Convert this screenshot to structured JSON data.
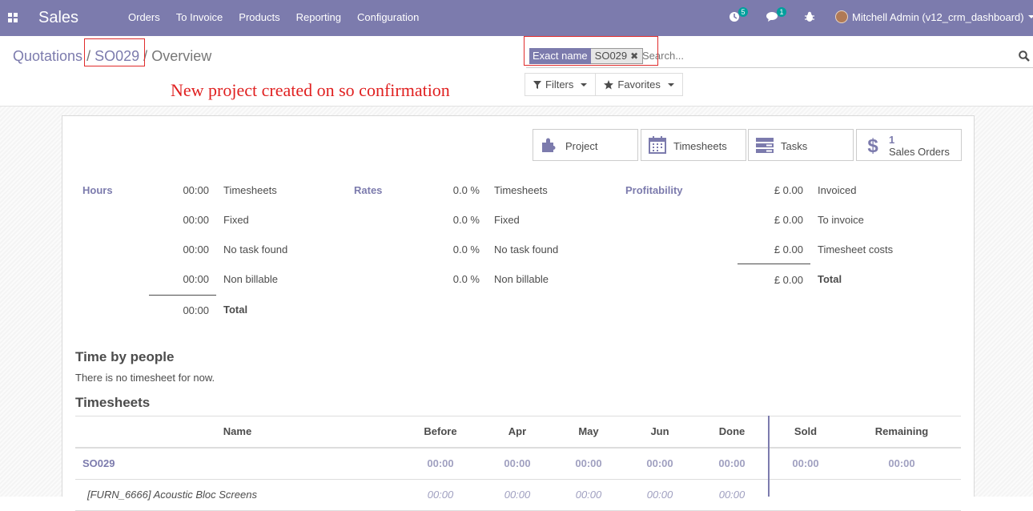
{
  "navbar": {
    "app_name": "Sales",
    "menu": [
      "Orders",
      "To Invoice",
      "Products",
      "Reporting",
      "Configuration"
    ],
    "activity_count": "5",
    "message_count": "1",
    "user_name": "Mitchell Admin (v12_crm_dashboard)"
  },
  "breadcrumb": {
    "items": [
      "Quotations",
      "SO029"
    ],
    "separator": "/",
    "current": "Overview"
  },
  "annotation": "New project created on so confirmation",
  "search": {
    "facet_label": "Exact name",
    "facet_value": "SO029",
    "placeholder": "Search..."
  },
  "buttons": {
    "filters": "Filters",
    "favorites": "Favorites"
  },
  "stat_buttons": {
    "project": "Project",
    "timesheets": "Timesheets",
    "tasks": "Tasks",
    "sales_orders_count": "1",
    "sales_orders": "Sales Orders"
  },
  "summary": {
    "hours": {
      "title": "Hours",
      "rows": [
        {
          "value": "00:00",
          "label": "Timesheets"
        },
        {
          "value": "00:00",
          "label": "Fixed"
        },
        {
          "value": "00:00",
          "label": "No task found"
        },
        {
          "value": "00:00",
          "label": "Non billable"
        },
        {
          "value": "00:00",
          "label": "Total"
        }
      ]
    },
    "rates": {
      "title": "Rates",
      "rows": [
        {
          "value": "0.0 %",
          "label": "Timesheets"
        },
        {
          "value": "0.0 %",
          "label": "Fixed"
        },
        {
          "value": "0.0 %",
          "label": "No task found"
        },
        {
          "value": "0.0 %",
          "label": "Non billable"
        }
      ]
    },
    "profitability": {
      "title": "Profitability",
      "rows": [
        {
          "value": "£ 0.00",
          "label": "Invoiced"
        },
        {
          "value": "£ 0.00",
          "label": "To invoice"
        },
        {
          "value": "£ 0.00",
          "label": "Timesheet costs"
        },
        {
          "value": "£ 0.00",
          "label": "Total"
        }
      ]
    }
  },
  "time_by_people": {
    "title": "Time by people",
    "empty_text": "There is no timesheet for now."
  },
  "timesheets": {
    "title": "Timesheets",
    "columns": [
      "Name",
      "Before",
      "Apr",
      "May",
      "Jun",
      "Done",
      "Sold",
      "Remaining"
    ],
    "rows": [
      {
        "name": "SO029",
        "values": [
          "00:00",
          "00:00",
          "00:00",
          "00:00",
          "00:00",
          "00:00",
          "00:00"
        ]
      },
      {
        "name": "[FURN_6666] Acoustic Bloc Screens",
        "values": [
          "00:00",
          "00:00",
          "00:00",
          "00:00",
          "00:00",
          "",
          ""
        ]
      }
    ]
  },
  "colors": {
    "brand": "#7c7bad",
    "highlight": "#e02b2b",
    "badge": "#00a09d"
  }
}
